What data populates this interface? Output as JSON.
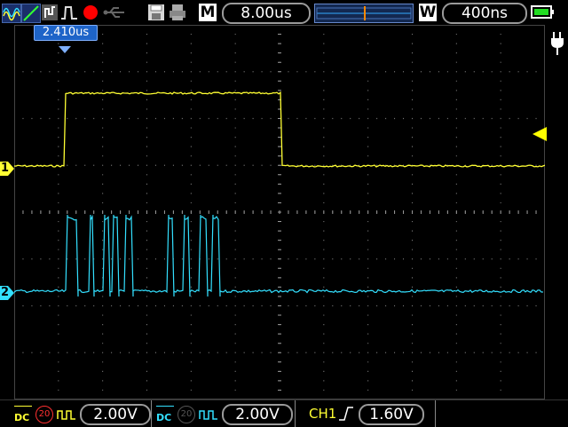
{
  "top": {
    "timebase_label": "M",
    "timebase_value": "8.00us",
    "window_label": "W",
    "window_value": "400ns",
    "icons": [
      "waveform-icon",
      "trend-icon",
      "cursor-icon",
      "pulse-icon",
      "record-icon",
      "usb-icon",
      "save-icon",
      "print-icon",
      "battery-icon",
      "power-plug-icon"
    ]
  },
  "trigger_position": "2.410us",
  "channels": {
    "ch1": {
      "marker": "1",
      "color": "#ffff33"
    },
    "ch2": {
      "marker": "2",
      "color": "#33e0ff"
    }
  },
  "bottom": {
    "ch1_coupling": "DC",
    "ch1_bw": "20",
    "ch1_scale": "2.00V",
    "ch2_coupling": "DC",
    "ch2_bw": "20",
    "ch2_scale": "2.00V",
    "trigger_source": "CH1",
    "trigger_level": "1.60V"
  }
}
